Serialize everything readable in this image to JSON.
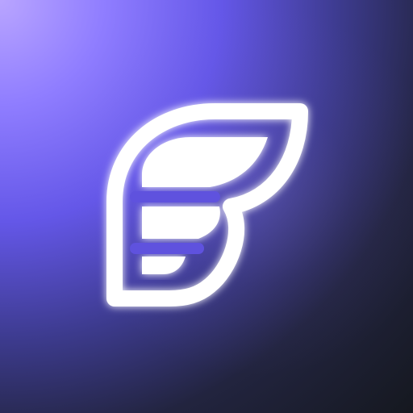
{
  "icon": {
    "name": "wing-logo-icon",
    "colors": {
      "background_light": "#b9a5ff",
      "background_mid": "#6457e8",
      "background_dark": "#15181f",
      "mark": "#ffffff"
    }
  }
}
